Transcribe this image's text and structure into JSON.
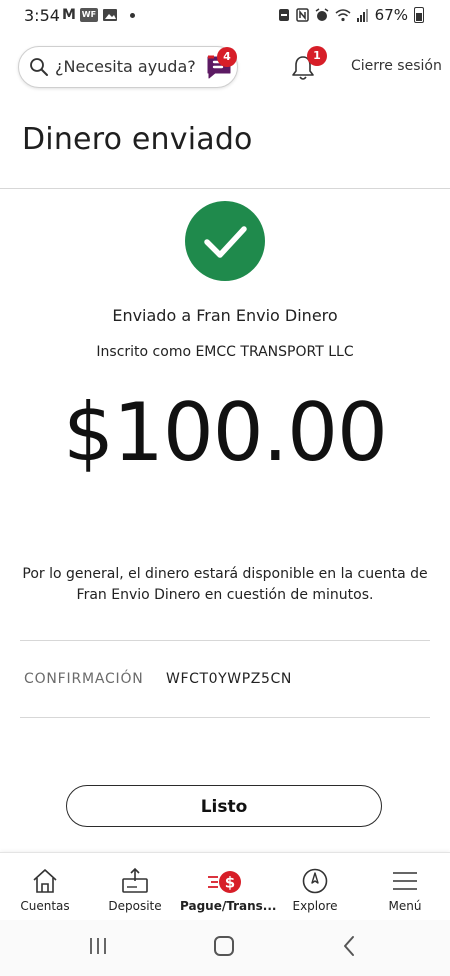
{
  "status_bar": {
    "time": "3:54",
    "battery": "67%",
    "icons": [
      "gmail-icon",
      "wf-icon",
      "gallery-icon",
      "dot-icon",
      "dnd-icon",
      "nfc-icon",
      "alarm-icon",
      "wifi-icon",
      "signal-icon",
      "battery-icon"
    ]
  },
  "header": {
    "search_placeholder": "¿Necesita ayuda?",
    "assistant_badge": "4",
    "notification_badge": "1",
    "logout_label": "Cierre sesión"
  },
  "page": {
    "title": "Dinero enviado"
  },
  "confirmation": {
    "sent_to": "Enviado a Fran Envio Dinero",
    "enrolled_as": "Inscrito como EMCC TRANSPORT LLC",
    "amount": "$100.00",
    "availability_text": "Por lo general, el dinero estará disponible en la cuenta de Fran Envio Dinero en cuestión de minutos.",
    "label": "CONFIRMACIÓN",
    "code": "WFCT0YWPZ5CN",
    "done_label": "Listo"
  },
  "bottom_nav": {
    "items": [
      {
        "label": "Cuentas",
        "icon": "home-icon"
      },
      {
        "label": "Deposite",
        "icon": "deposit-icon"
      },
      {
        "label": "Pague/Trans...",
        "icon": "pay-transfer-icon"
      },
      {
        "label": "Explore",
        "icon": "compass-icon"
      },
      {
        "label": "Menú",
        "icon": "menu-icon"
      }
    ],
    "active_index": 2
  },
  "colors": {
    "success_green": "#1f8a4c",
    "badge_red": "#d71e28",
    "assistant_purple": "#5c1a63"
  }
}
